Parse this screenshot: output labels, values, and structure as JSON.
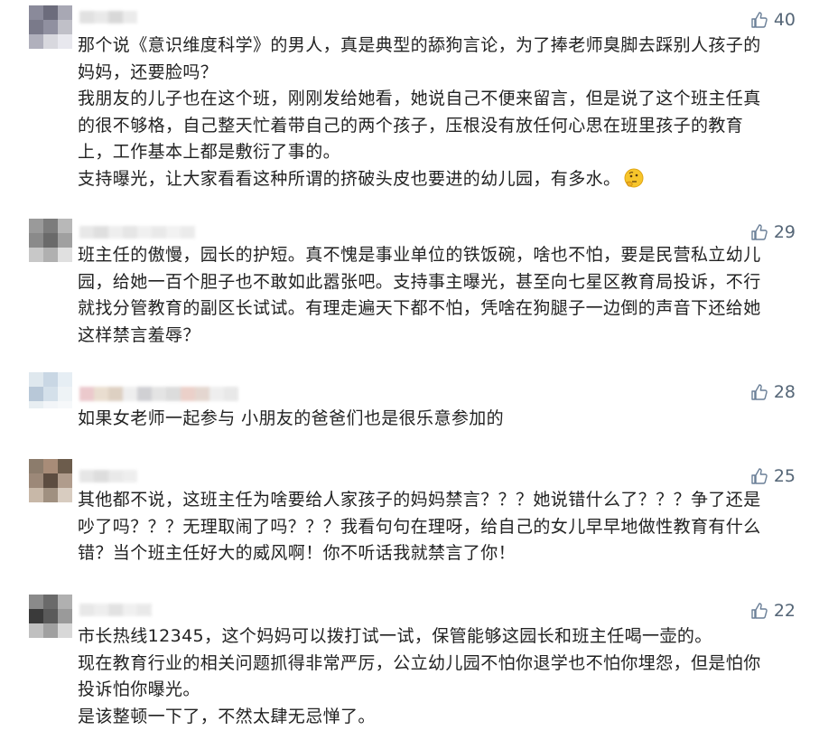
{
  "comments": [
    {
      "likes": "40",
      "paragraphs": [
        "那个说《意识维度科学》的男人，真是典型的舔狗言论，为了捧老师臭脚去踩别人孩子的妈妈，还要脸吗？",
        "我朋友的儿子也在这个班，刚刚发给她看，她说自己不便来留言，但是说了这个班主任真的很不够格，自己整天忙着带自己的两个孩子，压根没有放任何心思在班里孩子的教育上，工作基本上都是敷衍了事的。",
        "支持曝光，让大家看看这种所谓的挤破头皮也要进的幼儿园，有多水。"
      ],
      "emoji": "thinking-face"
    },
    {
      "likes": "29",
      "paragraphs": [
        "班主任的傲慢，园长的护短。真不愧是事业单位的铁饭碗，啥也不怕，要是民营私立幼儿园，给她一百个胆子也不敢如此嚣张吧。支持事主曝光，甚至向七星区教育局投诉，不行就找分管教育的副区长试试。有理走遍天下都不怕，凭啥在狗腿子一边倒的声音下还给她这样禁言羞辱？"
      ]
    },
    {
      "likes": "28",
      "paragraphs": [
        "如果女老师一起参与 小朋友的爸爸们也是很乐意参加的"
      ]
    },
    {
      "likes": "25",
      "paragraphs": [
        "其他都不说，这班主任为啥要给人家孩子的妈妈禁言？？？她说错什么了？？？争了还是吵了吗？？？无理取闹了吗？？？我看句句在理呀，给自己的女儿早早地做性教育有什么错？当个班主任好大的威风啊！你不听话我就禁言了你！"
      ]
    },
    {
      "likes": "22",
      "paragraphs": [
        "市长热线12345，这个妈妈可以拨打试一试，保管能够这园长和班主任喝一壶的。",
        "现在教育行业的相关问题抓得非常严厉，公立幼儿园不怕你退学也不怕你埋怨，但是怕你投诉怕你曝光。",
        "是该整顿一下了，不然太肆无忌惮了。"
      ]
    }
  ],
  "colors": {
    "text": "#222222",
    "like": "#556677",
    "background": "#ffffff"
  },
  "icons": {
    "like": "thumbs-up-icon",
    "emoji": "thinking-face-icon"
  }
}
